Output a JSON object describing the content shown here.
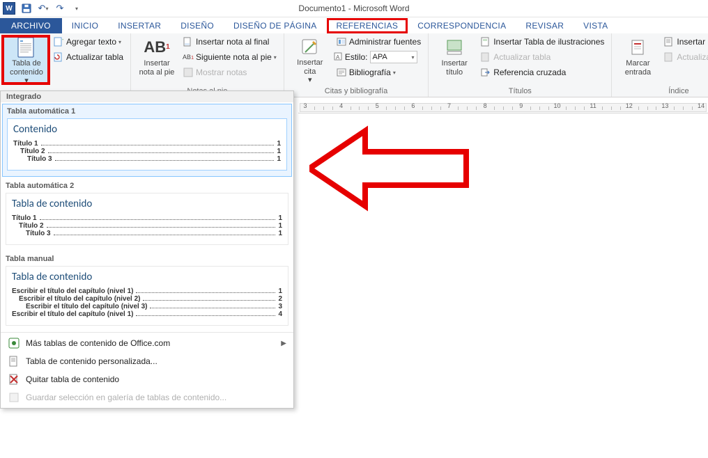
{
  "title": "Documento1 - Microsoft Word",
  "quick_access": {
    "save": "Guardar",
    "undo": "Deshacer",
    "redo": "Rehacer"
  },
  "tabs": {
    "file": "ARCHIVO",
    "home": "INICIO",
    "insert": "INSERTAR",
    "design": "DISEÑO",
    "layout": "DISEÑO DE PÁGINA",
    "references": "REFERENCIAS",
    "mailings": "CORRESPONDENCIA",
    "review": "REVISAR",
    "view": "VISTA"
  },
  "ribbon": {
    "toc_group": {
      "big": "Tabla de\ncontenido",
      "add_text": "Agregar texto",
      "update": "Actualizar tabla"
    },
    "footnotes": {
      "big": "Insertar\nnota al pie",
      "endnote": "Insertar nota al final",
      "next": "Siguiente nota al pie",
      "show": "Mostrar notas",
      "label": "Notas al pie"
    },
    "citations": {
      "big": "Insertar\ncita",
      "manage": "Administrar fuentes",
      "style_lbl": "Estilo:",
      "style_val": "APA",
      "biblio": "Bibliografía",
      "label": "Citas y bibliografía"
    },
    "captions": {
      "big": "Insertar\ntítulo",
      "tof": "Insertar Tabla de ilustraciones",
      "update": "Actualizar tabla",
      "crossref": "Referencia cruzada",
      "label": "Títulos"
    },
    "index": {
      "big": "Marcar\nentrada",
      "insert": "Insertar índice",
      "update": "Actualizar índice",
      "label": "Índice"
    }
  },
  "gallery": {
    "builtin": "Integrado",
    "auto1": {
      "name": "Tabla automática 1",
      "heading": "Contenido",
      "lines": [
        {
          "lbl": "Título 1",
          "pg": "1",
          "ind": 0
        },
        {
          "lbl": "Título 2",
          "pg": "1",
          "ind": 1
        },
        {
          "lbl": "Título 3",
          "pg": "1",
          "ind": 2
        }
      ]
    },
    "auto2": {
      "name": "Tabla automática 2",
      "heading": "Tabla de contenido",
      "lines": [
        {
          "lbl": "Título 1",
          "pg": "1",
          "ind": 0
        },
        {
          "lbl": "Título 2",
          "pg": "1",
          "ind": 1
        },
        {
          "lbl": "Título 3",
          "pg": "1",
          "ind": 2
        }
      ]
    },
    "manual": {
      "name": "Tabla manual",
      "heading": "Tabla de contenido",
      "lines": [
        {
          "lbl": "Escribir el título del capítulo (nivel 1)",
          "pg": "1",
          "ind": 0
        },
        {
          "lbl": "Escribir el título del capítulo (nivel 2)",
          "pg": "2",
          "ind": 1
        },
        {
          "lbl": "Escribir el título del capítulo (nivel 3)",
          "pg": "3",
          "ind": 2
        },
        {
          "lbl": "Escribir el título del capítulo (nivel 1)",
          "pg": "4",
          "ind": 0
        }
      ]
    },
    "more": "Más tablas de contenido de Office.com",
    "custom": "Tabla de contenido personalizada...",
    "remove": "Quitar tabla de contenido",
    "save_sel": "Guardar selección en galería de tablas de contenido..."
  },
  "ruler": {
    "start": 3,
    "end": 14
  }
}
